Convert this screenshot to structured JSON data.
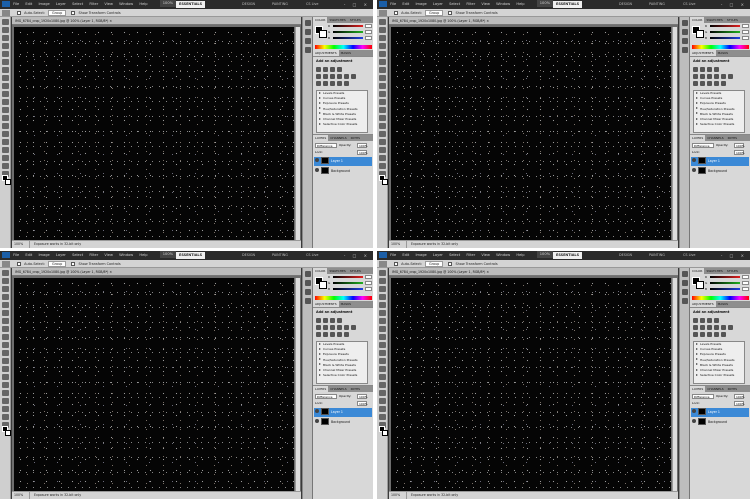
{
  "app": {
    "menu": [
      "File",
      "Edit",
      "Image",
      "Layer",
      "Select",
      "Filter",
      "View",
      "Window",
      "Help"
    ],
    "zoom": "100%",
    "workspaces": {
      "active": "ESSENTIALS",
      "b1": "DESIGN",
      "b2": "PAINTING",
      "cs": "CS Live"
    },
    "window_controls": "- □ ×"
  },
  "options_bar": {
    "auto_select_label": "Auto-Select:",
    "auto_select_value": "Group",
    "show_transform": "Show Transform Controls"
  },
  "document": {
    "tab_title": "IMG_6784_crop_1920x1080.jpg @ 100% (Layer 1, RGB/8*) ×",
    "status_zoom": "100%",
    "status_info": "Exposure works in 32-bit only"
  },
  "panels": {
    "color_tabs": [
      "COLOR",
      "SWATCHES",
      "STYLES"
    ],
    "channels": [
      "R",
      "G",
      "B"
    ],
    "channel_colors": [
      "#e02020",
      "#20b020",
      "#2040e0"
    ],
    "adj_tabs": [
      "ADJUSTMENTS",
      "MASKS"
    ],
    "adj_title": "Add an adjustment",
    "presets": [
      "Levels Presets",
      "Curves Presets",
      "Exposure Presets",
      "Hue/Saturation Presets",
      "Black & White Presets",
      "Channel Mixer Presets",
      "Selective Color Presets"
    ],
    "layers_tabs": [
      "LAYERS",
      "CHANNELS",
      "PATHS"
    ],
    "blend_mode": "Difference",
    "opacity_label": "Opacity:",
    "opacity": "100%",
    "lock_label": "Lock:",
    "fill_label": "Fill:",
    "fill": "100%",
    "layers": [
      {
        "name": "Layer 1",
        "selected": true
      },
      {
        "name": "Background",
        "selected": false
      }
    ]
  },
  "colors": {
    "selection": "#3b89d6",
    "canvas": "#050505",
    "menubar": "#2b2b2b"
  }
}
